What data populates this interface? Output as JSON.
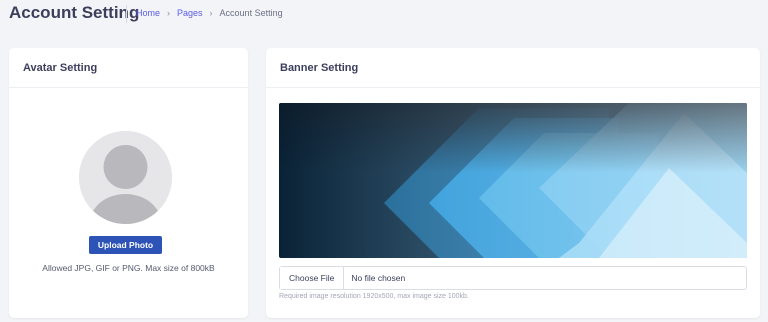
{
  "header": {
    "title": "Account Setting",
    "breadcrumb": {
      "home": "Home",
      "pages": "Pages",
      "current": "Account Setting"
    }
  },
  "avatar_card": {
    "title": "Avatar Setting",
    "upload_label": "Upload Photo",
    "hint": "Allowed JPG, GIF or PNG. Max size of 800kB"
  },
  "banner_card": {
    "title": "Banner Setting",
    "choose_file_label": "Choose File",
    "file_status": "No file chosen",
    "hint": "Required image resolution 1920x500, max image size 100kb."
  },
  "colors": {
    "background": "#f3f4f8",
    "primary_button": "#2c53b5",
    "link": "#5b5be4"
  },
  "icons": [
    "chevron-right-icon",
    "avatar-placeholder-icon"
  ]
}
